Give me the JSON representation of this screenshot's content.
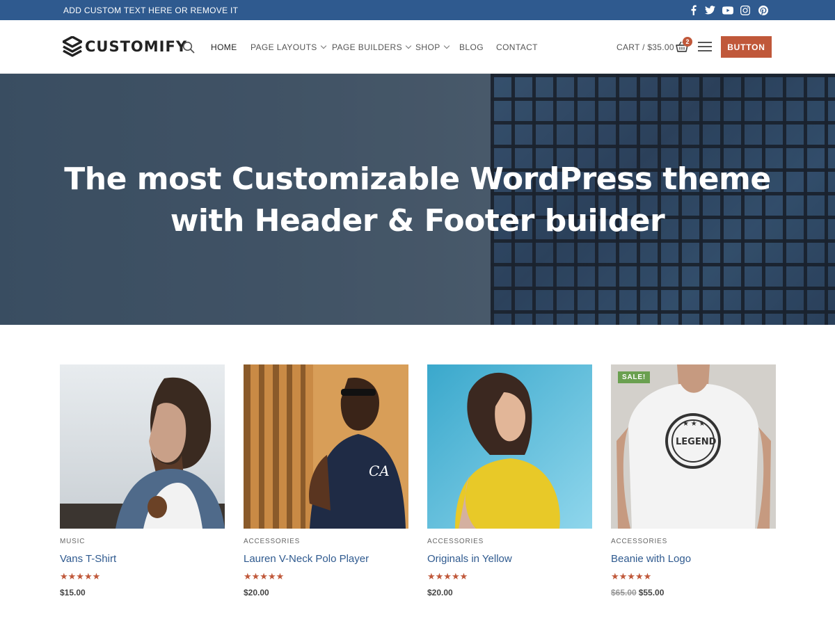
{
  "topbar": {
    "text": "ADD CUSTOM TEXT HERE OR REMOVE IT",
    "social_icons": [
      "facebook-icon",
      "twitter-icon",
      "youtube-icon",
      "instagram-icon",
      "pinterest-icon"
    ]
  },
  "header": {
    "logo_text": "CUSTOMIFY",
    "nav": [
      {
        "label": "HOME",
        "active": true
      },
      {
        "label": "PAGE LAYOUTS",
        "dropdown": true
      },
      {
        "label": "PAGE BUILDERS",
        "dropdown": true
      },
      {
        "label": "SHOP",
        "dropdown": true
      },
      {
        "label": "BLOG"
      },
      {
        "label": "CONTACT"
      }
    ],
    "cart_label": "CART / $35.00",
    "cart_count": "2",
    "button_label": "BUTTON"
  },
  "hero": {
    "title_line1": "The most Customizable WordPress theme",
    "title_line2": "with Header & Footer builder"
  },
  "products": [
    {
      "category": "MUSIC",
      "name": "Vans T-Shirt",
      "rating": 5,
      "stars": "★★★★★",
      "price": "$15.00"
    },
    {
      "category": "ACCESSORIES",
      "name": "Lauren V-Neck Polo Player",
      "rating": 5,
      "stars": "★★★★★",
      "price": "$20.00"
    },
    {
      "category": "ACCESSORIES",
      "name": "Originals in Yellow",
      "rating": 5,
      "stars": "★★★★★",
      "price": "$20.00"
    },
    {
      "category": "ACCESSORIES",
      "name": "Beanie with Logo",
      "rating": 5,
      "stars": "★★★★★",
      "old_price": "$65.00",
      "price": "$55.00",
      "badge": "SALE!"
    }
  ],
  "colors": {
    "topbar": "#2f5a8f",
    "accent": "#c0583a",
    "link": "#2f5a8f",
    "sale": "#6aa050"
  }
}
